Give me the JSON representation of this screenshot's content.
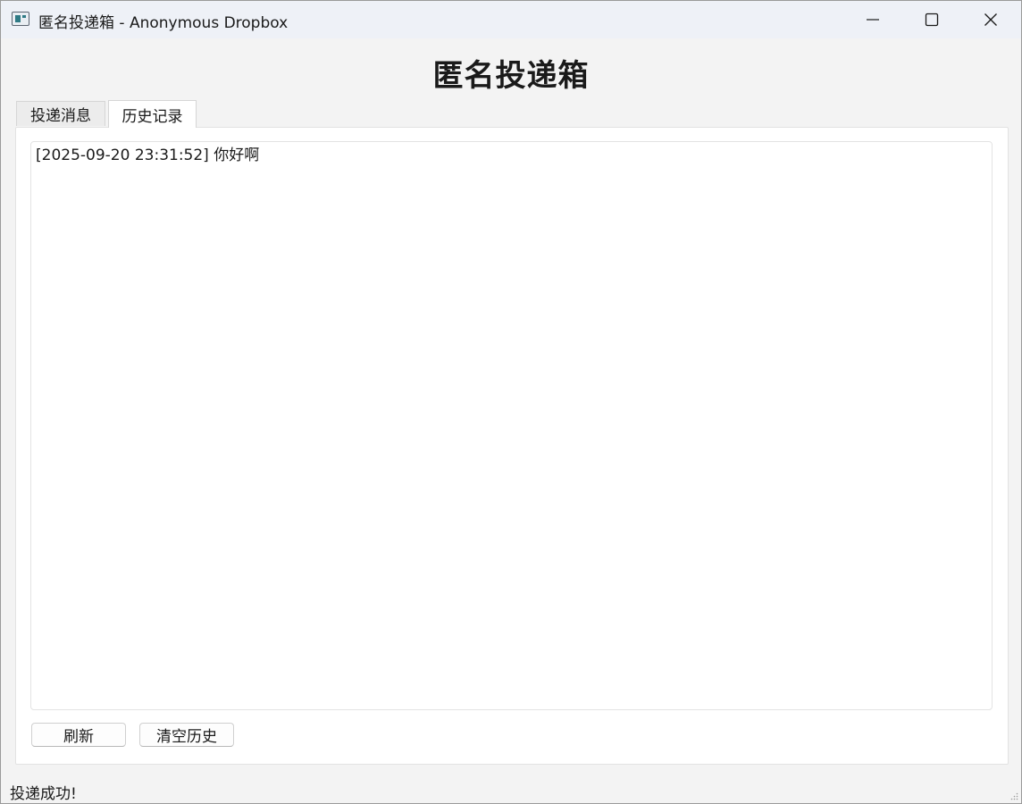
{
  "window": {
    "title": "匿名投递箱 - Anonymous Dropbox",
    "icon": "app-window-icon",
    "controls": [
      "minimize-icon",
      "maximize-icon",
      "close-icon"
    ]
  },
  "header": {
    "title": "匿名投递箱"
  },
  "tabs": [
    {
      "label": "投递消息",
      "selected": false
    },
    {
      "label": "历史记录",
      "selected": true
    }
  ],
  "history": {
    "entries": [
      "[2025-09-20 23:31:52] 你好啊"
    ]
  },
  "buttons": {
    "refresh_label": "刷新",
    "clear_label": "清空历史"
  },
  "status": {
    "text": "投递成功!"
  },
  "colors": {
    "window_bg": "#f3f3f3",
    "titlebar_bg": "#eef1f7",
    "panel_bg": "#ffffff",
    "text": "#1a1a1a"
  }
}
